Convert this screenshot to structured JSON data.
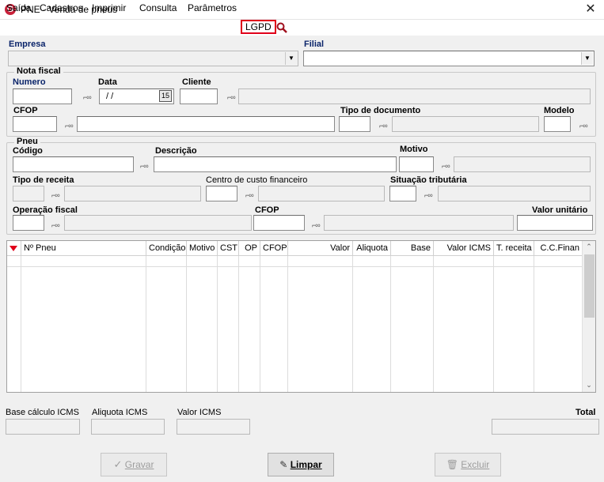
{
  "window": {
    "title": "PNE - Venda de pneus",
    "app_icon": "G",
    "close_glyph": "✕"
  },
  "menu": {
    "items": [
      "Saída",
      "Cadastros",
      "Imprimir",
      "Consulta",
      "Parâmetros"
    ],
    "lgpd": "LGPD",
    "search_icon": "search-icon",
    "highlight_color": "#e0001a"
  },
  "header": {
    "empresa_label": "Empresa",
    "filial_label": "Filial"
  },
  "nota_fiscal": {
    "legend": "Nota fiscal",
    "numero_label": "Numero",
    "data_label": "Data",
    "data_value": "/ /",
    "calendar_glyph": "15",
    "cliente_label": "Cliente",
    "cfop_label": "CFOP",
    "tipo_documento_label": "Tipo de documento",
    "modelo_label": "Modelo"
  },
  "pneu": {
    "legend": "Pneu",
    "codigo_label": "Código",
    "descricao_label": "Descrição",
    "motivo_label": "Motivo",
    "tipo_receita_label": "Tipo de receita",
    "centro_custo_label": "Centro de custo financeiro",
    "situacao_label": "Situação tributária",
    "operacao_label": "Operação fiscal",
    "cfop_label": "CFOP",
    "valor_unitario_label": "Valor unitário"
  },
  "table": {
    "columns": [
      "Nº Pneu",
      "Condição",
      "Motivo",
      "CST",
      "OP",
      "CFOP",
      "Valor",
      "Aliquota",
      "Base",
      "Valor ICMS",
      "T. receita",
      "C.C.Finan"
    ]
  },
  "totals": {
    "base_label": "Base cálculo ICMS",
    "aliquota_label": "Aliquota ICMS",
    "valor_label": "Valor ICMS",
    "total_label": "Total"
  },
  "buttons": {
    "gravar": "Gravar",
    "limpar": "Limpar",
    "excluir": "Excluir"
  },
  "colors": {
    "label_navy": "#0a246a",
    "accent": "#c9213a"
  }
}
